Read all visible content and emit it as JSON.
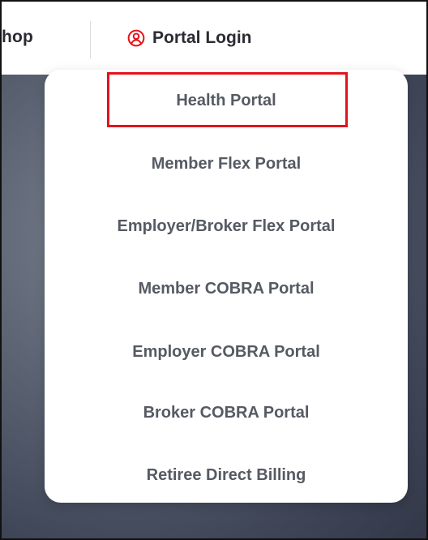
{
  "nav": {
    "shop_label_partial": "hop",
    "portal_login": {
      "icon": "user-circle-icon",
      "label": "Portal Login",
      "accent": "#e3131b"
    }
  },
  "dropdown": {
    "items": [
      {
        "label": "Health Portal",
        "highlighted": true
      },
      {
        "label": "Member Flex Portal"
      },
      {
        "label": "Employer/Broker Flex Portal"
      },
      {
        "label": "Member COBRA Portal"
      },
      {
        "label": "Employer COBRA Portal"
      },
      {
        "label": "Broker COBRA Portal"
      },
      {
        "label": "Retiree Direct Billing"
      }
    ],
    "highlight_color": "#e3131b"
  },
  "colors": {
    "text_dark": "#2b2b33",
    "menu_text": "#555a63",
    "background_dark": "#3f4658"
  }
}
